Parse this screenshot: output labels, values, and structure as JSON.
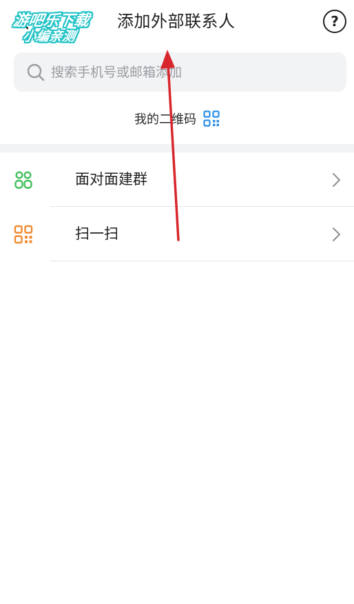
{
  "header": {
    "title": "添加外部联系人",
    "help_symbol": "?",
    "watermark_line1": "游吧乐下载",
    "watermark_line2": "小编亲测"
  },
  "search": {
    "placeholder": "搜索手机号或邮箱添加",
    "value": ""
  },
  "my_qr": {
    "label": "我的二维码"
  },
  "list": {
    "items": [
      {
        "label": "面对面建群",
        "icon": "people-group-icon"
      },
      {
        "label": "扫一扫",
        "icon": "qr-scan-icon"
      }
    ]
  },
  "colors": {
    "green_icon": "#3fbf5a",
    "orange_icon": "#f08a30",
    "blue_qr": "#2b8fe6",
    "annotation_red": "#d8262c",
    "watermark": "#22c3c7"
  }
}
